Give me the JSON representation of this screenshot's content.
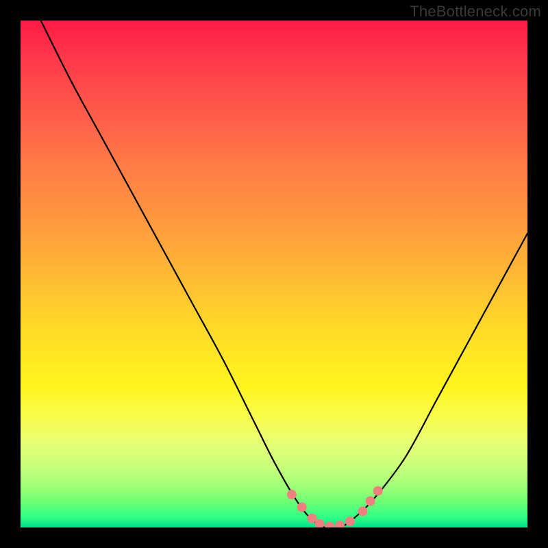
{
  "watermark": "TheBottleneck.com",
  "chart_data": {
    "type": "line",
    "title": "",
    "xlabel": "",
    "ylabel": "",
    "xlim": [
      0,
      100
    ],
    "ylim": [
      0,
      100
    ],
    "series": [
      {
        "name": "bottleneck-curve",
        "x": [
          4,
          10,
          16,
          22,
          28,
          34,
          40,
          46,
          50,
          54,
          57,
          60,
          63,
          66,
          70,
          76,
          82,
          88,
          94,
          100
        ],
        "values": [
          100,
          88,
          77,
          66,
          55,
          44,
          33,
          21,
          13,
          6,
          2,
          0,
          0,
          2,
          6,
          14,
          25,
          36,
          47,
          58
        ]
      }
    ],
    "markers": [
      {
        "name": "marker-left-upper",
        "x": 53.5,
        "y": 6.5
      },
      {
        "name": "marker-left-mid",
        "x": 55.5,
        "y": 4.0
      },
      {
        "name": "marker-left-lower",
        "x": 57.5,
        "y": 1.8
      },
      {
        "name": "marker-bottom-1",
        "x": 59.0,
        "y": 0.7
      },
      {
        "name": "marker-bottom-2",
        "x": 61.0,
        "y": 0.2
      },
      {
        "name": "marker-bottom-3",
        "x": 63.0,
        "y": 0.4
      },
      {
        "name": "marker-bottom-4",
        "x": 65.0,
        "y": 1.2
      },
      {
        "name": "marker-right-lower",
        "x": 67.5,
        "y": 3.2
      },
      {
        "name": "marker-right-mid",
        "x": 69.0,
        "y": 5.2
      },
      {
        "name": "marker-right-upper",
        "x": 70.5,
        "y": 7.2
      }
    ],
    "marker_color": "#f08080",
    "curve_color": "#000000"
  }
}
